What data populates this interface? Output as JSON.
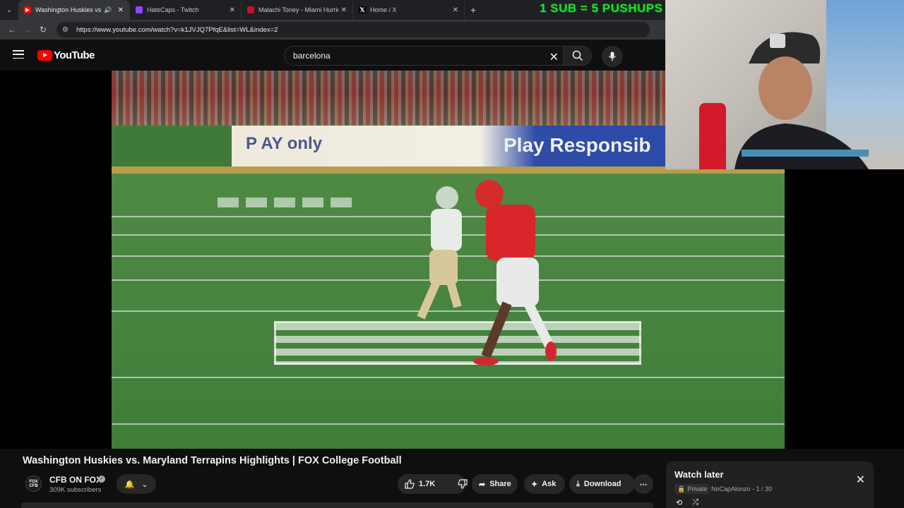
{
  "browser": {
    "tabs": [
      {
        "label": "Washington Huskies vs. Maryland",
        "active": true,
        "favicon": "youtube-icon",
        "color": "#ff0000"
      },
      {
        "label": "HateCaps - Twitch",
        "active": false,
        "favicon": "twitch-icon",
        "color": "#9146ff"
      },
      {
        "label": "Malachi Toney - Miami Hurricane",
        "active": false,
        "favicon": "site-icon",
        "color": "#c8102e"
      },
      {
        "label": "Home / X",
        "active": false,
        "favicon": "x-icon",
        "color": "#000000"
      }
    ],
    "url": "https://www.youtube.com/watch?v=k1JVJQ7PfqE&list=WL&index=2"
  },
  "overlay": {
    "text": "1 SUB = 5 PUSHUPS",
    "color": "#21e021"
  },
  "youtube": {
    "logo_text": "YouTube",
    "search_value": "barcelona"
  },
  "video": {
    "title": "Washington Huskies vs. Maryland Terrapins Highlights | FOX College Football",
    "board_left": "P  AY  only",
    "board_right": "Play Responsib"
  },
  "channel": {
    "name": "CFB ON FOX",
    "logo_text": "FOX CFB",
    "subscribers": "309K subscribers"
  },
  "actions": {
    "likes": "1.7K",
    "share": "Share",
    "ask": "Ask",
    "download": "Download"
  },
  "playlist": {
    "title": "Watch later",
    "privacy": "Private",
    "owner_progress": "NoCapAlonzo - 1 / 30"
  }
}
